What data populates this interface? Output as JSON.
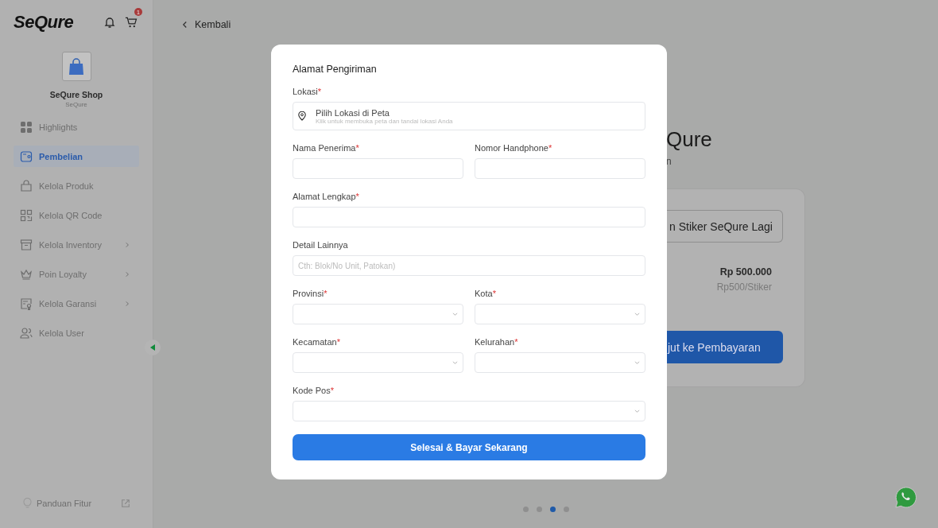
{
  "sidebar": {
    "logo": "SeQure",
    "cart_badge": "1",
    "shop_name": "SeQure Shop",
    "shop_subtitle": "SeQure",
    "items": [
      {
        "label": "Highlights",
        "selected": false,
        "expandable": false
      },
      {
        "label": "Pembelian",
        "selected": true,
        "expandable": false
      },
      {
        "label": "Kelola Produk",
        "selected": false,
        "expandable": false
      },
      {
        "label": "Kelola QR Code",
        "selected": false,
        "expandable": false
      },
      {
        "label": "Kelola Inventory",
        "selected": false,
        "expandable": true
      },
      {
        "label": "Poin Loyalty",
        "selected": false,
        "expandable": true
      },
      {
        "label": "Kelola Garansi",
        "selected": false,
        "expandable": true
      },
      {
        "label": "Kelola User",
        "selected": false,
        "expandable": false
      }
    ],
    "footer": "Panduan Fitur"
  },
  "back_link": "Kembali",
  "background": {
    "title": "Qure",
    "subtitle": "n",
    "outline_button": "n Stiker SeQure Lagi",
    "price": "Rp 500.000",
    "unit_price": "Rp500/Stiker",
    "primary_button": "jut ke Pembayaran"
  },
  "pager": [
    {
      "selected": false
    },
    {
      "selected": false
    },
    {
      "selected": true
    },
    {
      "selected": false
    }
  ],
  "modal": {
    "title": "Alamat Pengiriman",
    "location": {
      "label": "Lokasi",
      "required_mark": "*",
      "title": "Pilih Lokasi di Peta",
      "hint": "Klik untuk membuka peta dan tandai lokasi Anda"
    },
    "rows": [
      [
        {
          "label": "Nama Penerima",
          "required_mark": "*",
          "kind": "text"
        },
        {
          "label": "Nomor Handphone",
          "required_mark": "*",
          "kind": "text"
        }
      ],
      [
        {
          "label": "Alamat Lengkap",
          "required_mark": "*",
          "kind": "text"
        }
      ],
      [
        {
          "label": "Detail Lainnya",
          "kind": "text",
          "placeholder": "Cth: Blok/No Unit, Patokan)"
        }
      ],
      [
        {
          "label": "Provinsi",
          "required_mark": "*",
          "kind": "select"
        },
        {
          "label": "Kota",
          "required_mark": "*",
          "kind": "select"
        }
      ],
      [
        {
          "label": "Kecamatan",
          "required_mark": "*",
          "kind": "select"
        },
        {
          "label": "Kelurahan",
          "required_mark": "*",
          "kind": "select"
        }
      ],
      [
        {
          "label": "Kode Pos",
          "required_mark": "*",
          "kind": "select"
        }
      ]
    ],
    "submit": "Selesai & Bayar Sekarang"
  }
}
